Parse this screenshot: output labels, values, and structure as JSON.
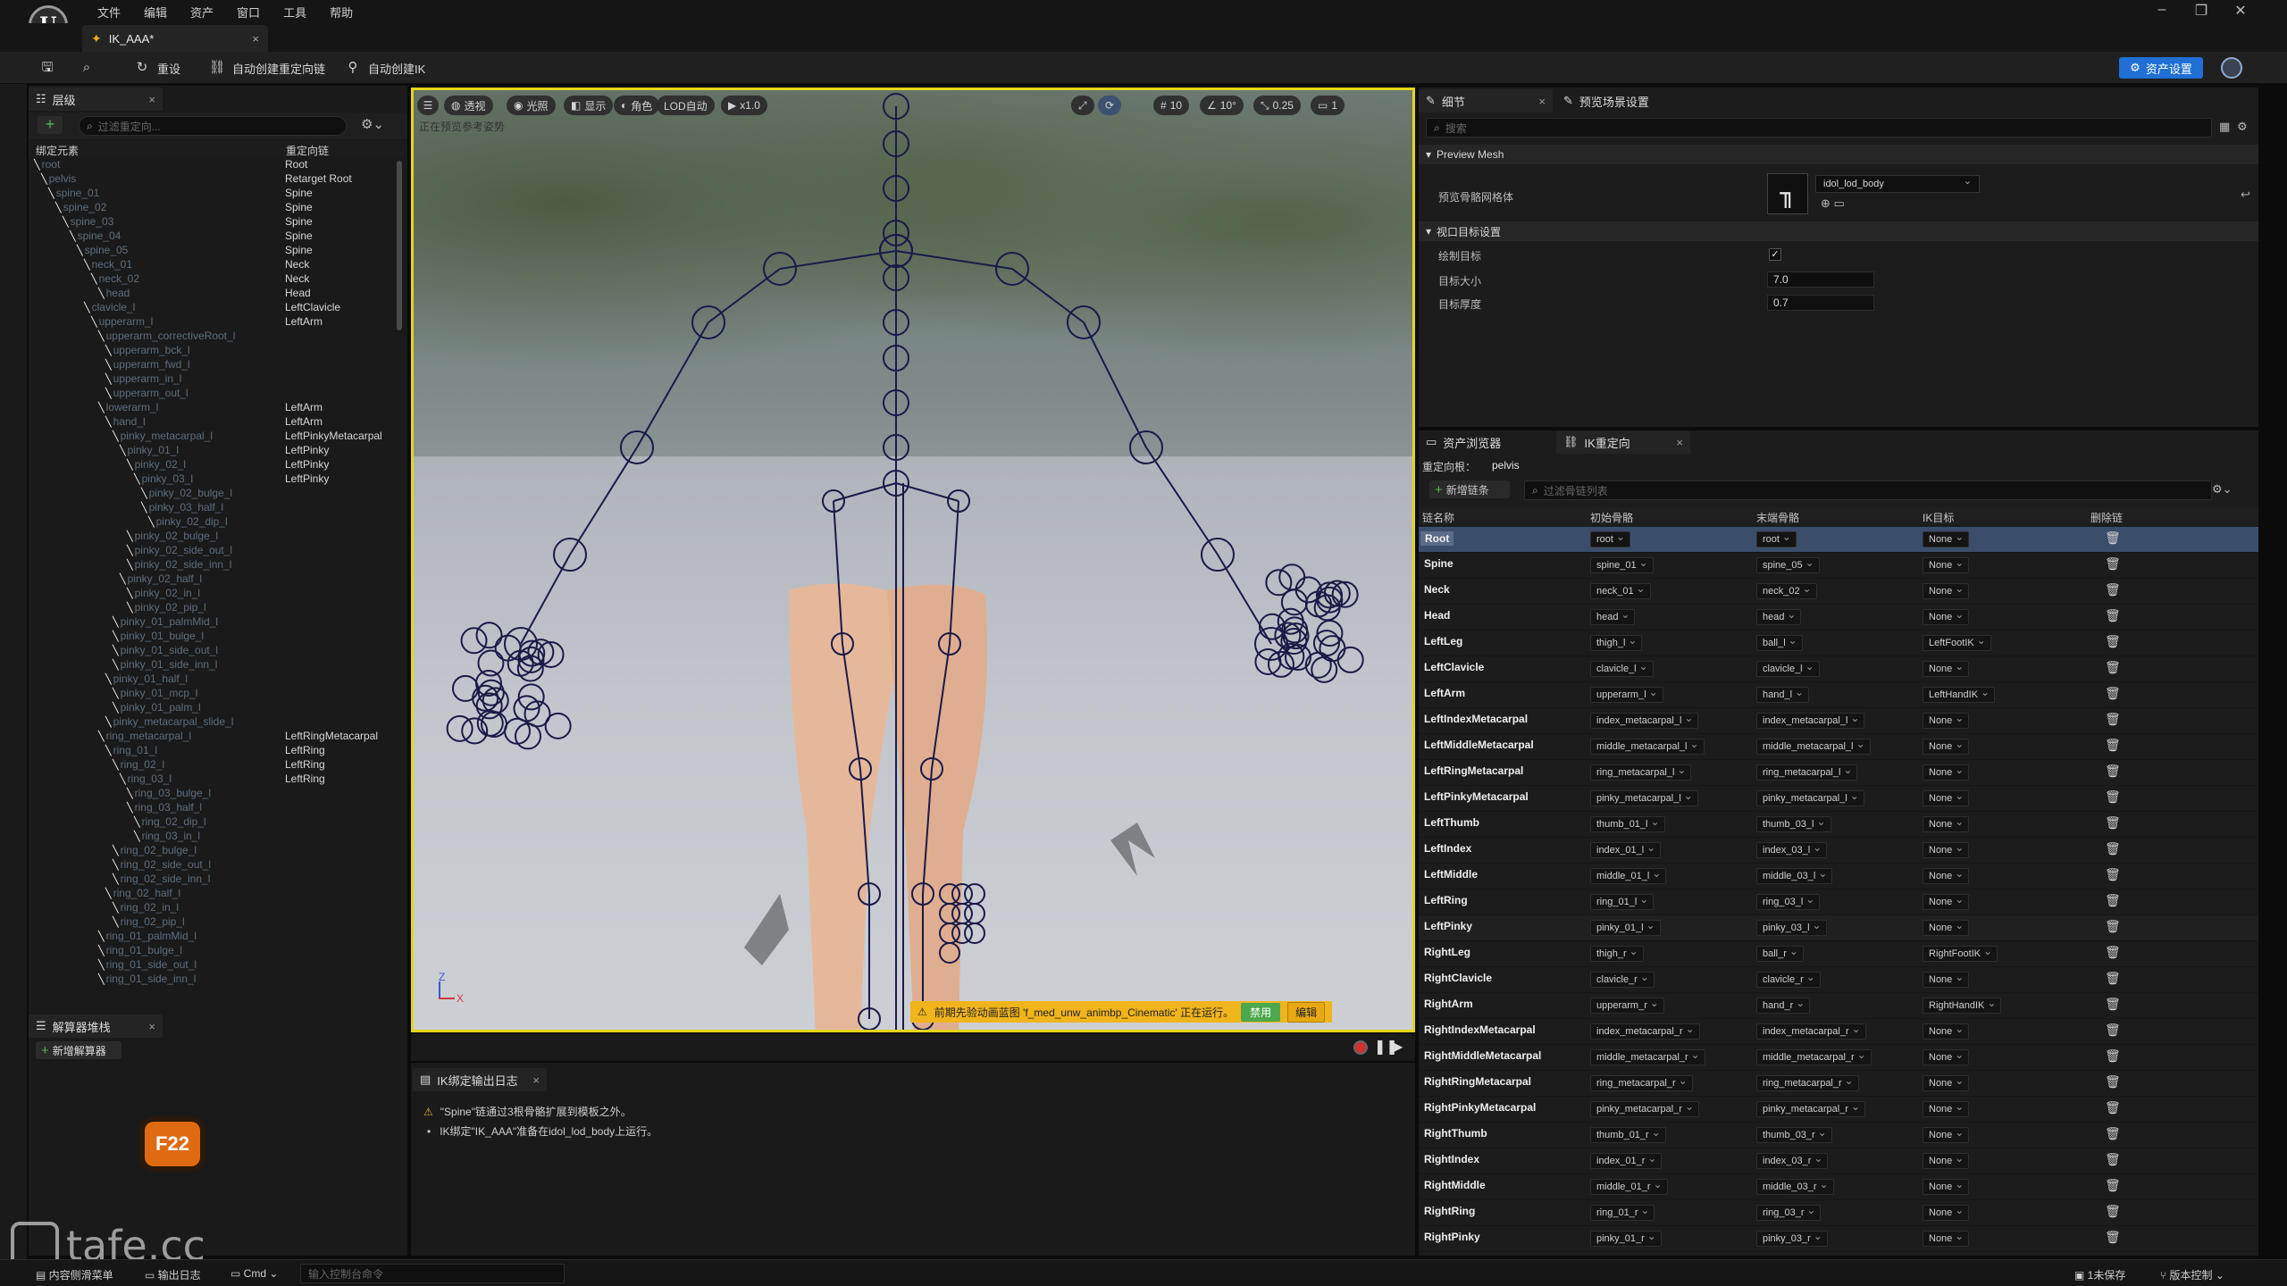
{
  "menu": {
    "items": [
      "文件",
      "编辑",
      "资产",
      "窗口",
      "工具",
      "帮助"
    ],
    "logo": "U"
  },
  "doc_tab": {
    "title": "IK_AAA*"
  },
  "toolbar": {
    "reset_label": "重设",
    "auto_retarget_label": "自动创建重定向链",
    "auto_ik_label": "自动创建IK",
    "asset_settings_label": "资产设置"
  },
  "hierarchy": {
    "tab_label": "层级",
    "search_placeholder": "过滤重定向...",
    "col_bone": "绑定元素",
    "col_chain": "重定向链",
    "rows": [
      {
        "indent": 0,
        "bone": "root",
        "chain": "Root"
      },
      {
        "indent": 1,
        "bone": "pelvis",
        "chain": "Retarget Root"
      },
      {
        "indent": 2,
        "bone": "spine_01",
        "chain": "Spine"
      },
      {
        "indent": 3,
        "bone": "spine_02",
        "chain": "Spine"
      },
      {
        "indent": 4,
        "bone": "spine_03",
        "chain": "Spine"
      },
      {
        "indent": 5,
        "bone": "spine_04",
        "chain": "Spine"
      },
      {
        "indent": 6,
        "bone": "spine_05",
        "chain": "Spine"
      },
      {
        "indent": 7,
        "bone": "neck_01",
        "chain": "Neck"
      },
      {
        "indent": 8,
        "bone": "neck_02",
        "chain": "Neck"
      },
      {
        "indent": 9,
        "bone": "head",
        "chain": "Head"
      },
      {
        "indent": 7,
        "bone": "clavicle_l",
        "chain": "LeftClavicle"
      },
      {
        "indent": 8,
        "bone": "upperarm_l",
        "chain": "LeftArm"
      },
      {
        "indent": 9,
        "bone": "upperarm_correctiveRoot_l",
        "chain": ""
      },
      {
        "indent": 10,
        "bone": "upperarm_bck_l",
        "chain": ""
      },
      {
        "indent": 10,
        "bone": "upperarm_fwd_l",
        "chain": ""
      },
      {
        "indent": 10,
        "bone": "upperarm_in_l",
        "chain": ""
      },
      {
        "indent": 10,
        "bone": "upperarm_out_l",
        "chain": ""
      },
      {
        "indent": 9,
        "bone": "lowerarm_l",
        "chain": "LeftArm"
      },
      {
        "indent": 10,
        "bone": "hand_l",
        "chain": "LeftArm"
      },
      {
        "indent": 11,
        "bone": "pinky_metacarpal_l",
        "chain": "LeftPinkyMetacarpal"
      },
      {
        "indent": 12,
        "bone": "pinky_01_l",
        "chain": "LeftPinky"
      },
      {
        "indent": 13,
        "bone": "pinky_02_l",
        "chain": "LeftPinky"
      },
      {
        "indent": 14,
        "bone": "pinky_03_l",
        "chain": "LeftPinky"
      },
      {
        "indent": 15,
        "bone": "pinky_02_bulge_l",
        "chain": ""
      },
      {
        "indent": 15,
        "bone": "pinky_03_half_l",
        "chain": ""
      },
      {
        "indent": 16,
        "bone": "pinky_02_dip_l",
        "chain": ""
      },
      {
        "indent": 13,
        "bone": "pinky_02_bulge_l",
        "chain": ""
      },
      {
        "indent": 13,
        "bone": "pinky_02_side_out_l",
        "chain": ""
      },
      {
        "indent": 13,
        "bone": "pinky_02_side_inn_l",
        "chain": ""
      },
      {
        "indent": 12,
        "bone": "pinky_02_half_l",
        "chain": ""
      },
      {
        "indent": 13,
        "bone": "pinky_02_in_l",
        "chain": ""
      },
      {
        "indent": 13,
        "bone": "pinky_02_pip_l",
        "chain": ""
      },
      {
        "indent": 11,
        "bone": "pinky_01_palmMid_l",
        "chain": ""
      },
      {
        "indent": 11,
        "bone": "pinky_01_bulge_l",
        "chain": ""
      },
      {
        "indent": 11,
        "bone": "pinky_01_side_out_l",
        "chain": ""
      },
      {
        "indent": 11,
        "bone": "pinky_01_side_inn_l",
        "chain": ""
      },
      {
        "indent": 10,
        "bone": "pinky_01_half_l",
        "chain": ""
      },
      {
        "indent": 11,
        "bone": "pinky_01_mcp_l",
        "chain": ""
      },
      {
        "indent": 11,
        "bone": "pinky_01_palm_l",
        "chain": ""
      },
      {
        "indent": 10,
        "bone": "pinky_metacarpal_slide_l",
        "chain": ""
      },
      {
        "indent": 9,
        "bone": "ring_metacarpal_l",
        "chain": "LeftRingMetacarpal"
      },
      {
        "indent": 10,
        "bone": "ring_01_l",
        "chain": "LeftRing"
      },
      {
        "indent": 11,
        "bone": "ring_02_l",
        "chain": "LeftRing"
      },
      {
        "indent": 12,
        "bone": "ring_03_l",
        "chain": "LeftRing"
      },
      {
        "indent": 13,
        "bone": "ring_03_bulge_l",
        "chain": ""
      },
      {
        "indent": 13,
        "bone": "ring_03_half_l",
        "chain": ""
      },
      {
        "indent": 14,
        "bone": "ring_02_dip_l",
        "chain": ""
      },
      {
        "indent": 14,
        "bone": "ring_03_in_l",
        "chain": ""
      },
      {
        "indent": 11,
        "bone": "ring_02_bulge_l",
        "chain": ""
      },
      {
        "indent": 11,
        "bone": "ring_02_side_out_l",
        "chain": ""
      },
      {
        "indent": 11,
        "bone": "ring_02_side_inn_l",
        "chain": ""
      },
      {
        "indent": 10,
        "bone": "ring_02_half_l",
        "chain": ""
      },
      {
        "indent": 11,
        "bone": "ring_02_in_l",
        "chain": ""
      },
      {
        "indent": 11,
        "bone": "ring_02_pip_l",
        "chain": ""
      },
      {
        "indent": 9,
        "bone": "ring_01_palmMid_l",
        "chain": ""
      },
      {
        "indent": 9,
        "bone": "ring_01_bulge_l",
        "chain": ""
      },
      {
        "indent": 9,
        "bone": "ring_01_side_out_l",
        "chain": ""
      },
      {
        "indent": 9,
        "bone": "ring_01_side_inn_l",
        "chain": ""
      }
    ]
  },
  "solver": {
    "tab_label": "解算器堆栈",
    "add_label": "新增解算器"
  },
  "f22": "F22",
  "watermark": "tafe.cc",
  "viewport": {
    "buttons": [
      "透视",
      "光照",
      "显示",
      "角色",
      "LOD自动",
      "x1.0"
    ],
    "right_controls": [
      "10",
      "10°",
      "0.25",
      "1"
    ],
    "info_text": "正在预览参考姿势",
    "warning_text": "前期先验动画蓝图 'f_med_unw_animbp_Cinematic' 正在运行。",
    "disable_label": "禁用",
    "edit_label": "编辑",
    "axis_z": "Z",
    "axis_x": "X"
  },
  "log": {
    "tab_label": "IK绑定输出日志",
    "lines": [
      "\"Spine\"链通过3根骨骼扩展到模板之外。",
      "IK绑定\"IK_AAA\"准备在idol_lod_body上运行。"
    ]
  },
  "details": {
    "tab_label": "细节",
    "tab2_label": "预览场景设置",
    "search_placeholder": "搜索",
    "section_mesh": "Preview Mesh",
    "mesh_label": "预览骨骼网格体",
    "mesh_value": "idol_lod_body",
    "section_goal": "视口目标设置",
    "draw_goal_label": "绘制目标",
    "goal_size_label": "目标大小",
    "goal_size_value": "7.0",
    "goal_thickness_label": "目标厚度",
    "goal_thickness_value": "0.7"
  },
  "retarget": {
    "tab1_label": "资产浏览器",
    "tab2_label": "IK重定向",
    "root_label": "重定向根：",
    "root_value": "pelvis",
    "add_chain_label": "新增链条",
    "search_placeholder": "过滤骨链列表",
    "columns": [
      "链名称",
      "初始骨骼",
      "末端骨骼",
      "IK目标",
      "删除链"
    ],
    "rows": [
      {
        "name": "Root",
        "start": "root",
        "end": "root",
        "goal": "None"
      },
      {
        "name": "Spine",
        "start": "spine_01",
        "end": "spine_05",
        "goal": "None"
      },
      {
        "name": "Neck",
        "start": "neck_01",
        "end": "neck_02",
        "goal": "None"
      },
      {
        "name": "Head",
        "start": "head",
        "end": "head",
        "goal": "None"
      },
      {
        "name": "LeftLeg",
        "start": "thigh_l",
        "end": "ball_l",
        "goal": "LeftFootIK"
      },
      {
        "name": "LeftClavicle",
        "start": "clavicle_l",
        "end": "clavicle_l",
        "goal": "None"
      },
      {
        "name": "LeftArm",
        "start": "upperarm_l",
        "end": "hand_l",
        "goal": "LeftHandIK"
      },
      {
        "name": "LeftIndexMetacarpal",
        "start": "index_metacarpal_l",
        "end": "index_metacarpal_l",
        "goal": "None"
      },
      {
        "name": "LeftMiddleMetacarpal",
        "start": "middle_metacarpal_l",
        "end": "middle_metacarpal_l",
        "goal": "None"
      },
      {
        "name": "LeftRingMetacarpal",
        "start": "ring_metacarpal_l",
        "end": "ring_metacarpal_l",
        "goal": "None"
      },
      {
        "name": "LeftPinkyMetacarpal",
        "start": "pinky_metacarpal_l",
        "end": "pinky_metacarpal_l",
        "goal": "None"
      },
      {
        "name": "LeftThumb",
        "start": "thumb_01_l",
        "end": "thumb_03_l",
        "goal": "None"
      },
      {
        "name": "LeftIndex",
        "start": "index_01_l",
        "end": "index_03_l",
        "goal": "None"
      },
      {
        "name": "LeftMiddle",
        "start": "middle_01_l",
        "end": "middle_03_l",
        "goal": "None"
      },
      {
        "name": "LeftRing",
        "start": "ring_01_l",
        "end": "ring_03_l",
        "goal": "None"
      },
      {
        "name": "LeftPinky",
        "start": "pinky_01_l",
        "end": "pinky_03_l",
        "goal": "None"
      },
      {
        "name": "RightLeg",
        "start": "thigh_r",
        "end": "ball_r",
        "goal": "RightFootIK"
      },
      {
        "name": "RightClavicle",
        "start": "clavicle_r",
        "end": "clavicle_r",
        "goal": "None"
      },
      {
        "name": "RightArm",
        "start": "upperarm_r",
        "end": "hand_r",
        "goal": "RightHandIK"
      },
      {
        "name": "RightIndexMetacarpal",
        "start": "index_metacarpal_r",
        "end": "index_metacarpal_r",
        "goal": "None"
      },
      {
        "name": "RightMiddleMetacarpal",
        "start": "middle_metacarpal_r",
        "end": "middle_metacarpal_r",
        "goal": "None"
      },
      {
        "name": "RightRingMetacarpal",
        "start": "ring_metacarpal_r",
        "end": "ring_metacarpal_r",
        "goal": "None"
      },
      {
        "name": "RightPinkyMetacarpal",
        "start": "pinky_metacarpal_r",
        "end": "pinky_metacarpal_r",
        "goal": "None"
      },
      {
        "name": "RightThumb",
        "start": "thumb_01_r",
        "end": "thumb_03_r",
        "goal": "None"
      },
      {
        "name": "RightIndex",
        "start": "index_01_r",
        "end": "index_03_r",
        "goal": "None"
      },
      {
        "name": "RightMiddle",
        "start": "middle_01_r",
        "end": "middle_03_r",
        "goal": "None"
      },
      {
        "name": "RightRing",
        "start": "ring_01_r",
        "end": "ring_03_r",
        "goal": "None"
      },
      {
        "name": "RightPinky",
        "start": "pinky_01_r",
        "end": "pinky_03_r",
        "goal": "None"
      }
    ]
  },
  "statusbar": {
    "content_drawer": "内容侧滑菜单",
    "output_log": "输出日志",
    "cmd": "Cmd",
    "console_placeholder": "输入控制台命令",
    "unsaved": "1未保存",
    "source_control": "版本控制"
  },
  "colors": {
    "accent": "#1f6fd4",
    "viewport_border": "#e4d61a",
    "selected_row": "#3a4e6c",
    "warning": "#f0b41c"
  }
}
